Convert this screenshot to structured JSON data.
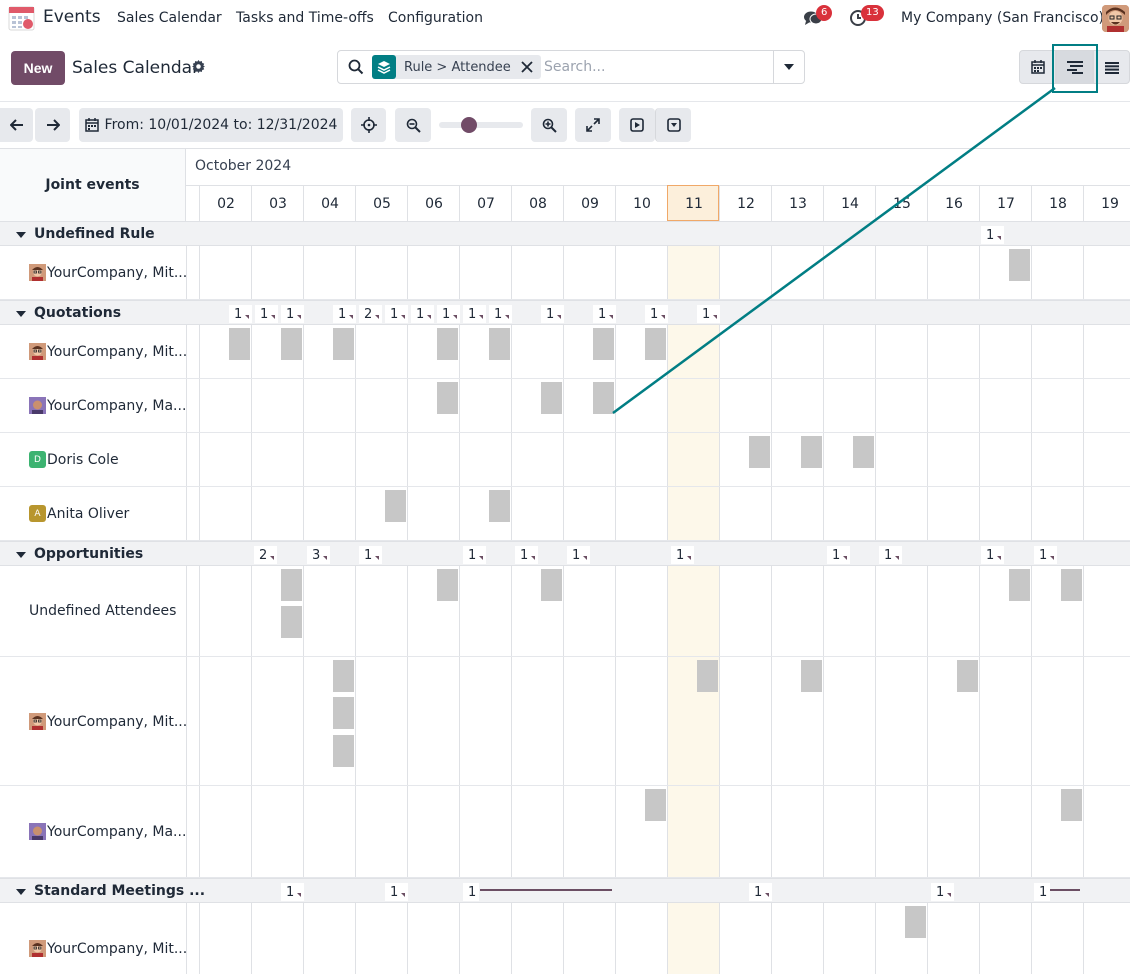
{
  "navbar": {
    "app_name": "Events",
    "menus": [
      "Sales Calendar",
      "Tasks and Time-offs",
      "Configuration"
    ],
    "messages_count": "6",
    "activities_count": "13",
    "company": "My Company (San Francisco)"
  },
  "control_panel": {
    "new_label": "New",
    "title": "Sales Calendar",
    "facet_label": "Rule > Attendee",
    "search_placeholder": "Search..."
  },
  "toolbar": {
    "range_label": "From: 10/01/2024 to: 12/31/2024"
  },
  "gantt": {
    "title": "Joint events",
    "month": "October 2024",
    "days": [
      "02",
      "03",
      "04",
      "05",
      "06",
      "07",
      "08",
      "09",
      "10",
      "11",
      "12",
      "13",
      "14",
      "15",
      "16",
      "17",
      "18",
      "19"
    ],
    "today": "11",
    "groups": [
      {
        "label": "Undefined Rule"
      },
      {
        "label": "Quotations"
      },
      {
        "label": "Opportunities"
      },
      {
        "label": "Standard Meetings ..."
      }
    ],
    "rows": [
      {
        "label": "YourCompany, Mit..."
      },
      {
        "label": "YourCompany, Mit..."
      },
      {
        "label": "YourCompany, Ma..."
      },
      {
        "label": "Doris Cole",
        "initial": "D"
      },
      {
        "label": "Anita Oliver",
        "initial": "A"
      },
      {
        "label": "Undefined Attendees"
      },
      {
        "label": "YourCompany, Mit..."
      },
      {
        "label": "YourCompany, Ma..."
      },
      {
        "label": "YourCompany, Mit..."
      }
    ],
    "counts": {
      "undefined_rule": [
        "1"
      ],
      "quotations": [
        "1",
        "1",
        "1",
        "1",
        "2",
        "1",
        "1",
        "1",
        "1",
        "1",
        "1",
        "1",
        "1",
        "1"
      ],
      "opportunities": [
        "2",
        "3",
        "1",
        "1",
        "1",
        "1",
        "1",
        "1",
        "1",
        "1",
        "1"
      ],
      "standard": [
        "1",
        "1",
        "1",
        "1",
        "1",
        "1"
      ]
    }
  },
  "colors": {
    "primary": "#714b67",
    "teal": "#017e84",
    "badge": "#d9313b",
    "pill": "#c7c7c7",
    "today": "#fdf8ea"
  }
}
